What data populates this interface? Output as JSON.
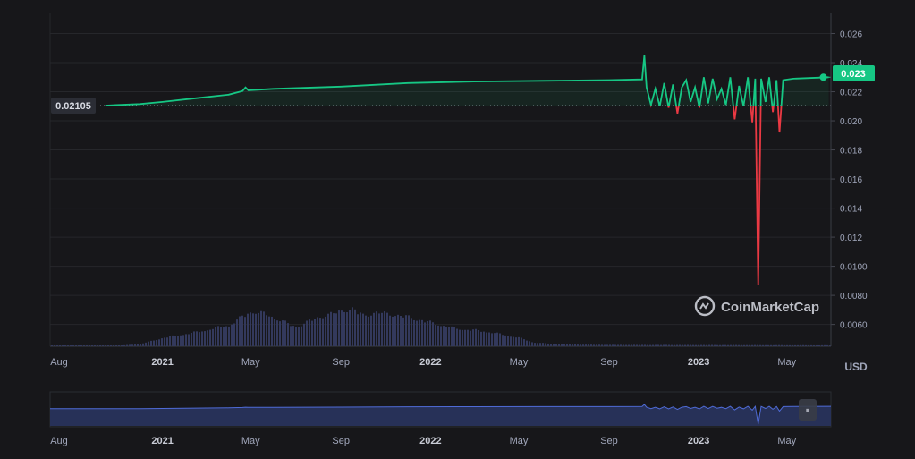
{
  "chart_data": {
    "type": "line",
    "currency_label": "USD",
    "watermark": "CoinMarketCap",
    "start_price_label": "0.02105",
    "start_price": 0.02105,
    "current_price_label": "0.023",
    "current_price": 0.023,
    "ylim": [
      0.0045,
      0.0272
    ],
    "y_ticks": [
      {
        "value": 0.026,
        "label": "0.026"
      },
      {
        "value": 0.024,
        "label": "0.024"
      },
      {
        "value": 0.022,
        "label": "0.022"
      },
      {
        "value": 0.02,
        "label": "0.020"
      },
      {
        "value": 0.018,
        "label": "0.018"
      },
      {
        "value": 0.016,
        "label": "0.016"
      },
      {
        "value": 0.014,
        "label": "0.014"
      },
      {
        "value": 0.012,
        "label": "0.012"
      },
      {
        "value": 0.01,
        "label": "0.0100"
      },
      {
        "value": 0.008,
        "label": "0.0080"
      },
      {
        "value": 0.006,
        "label": "0.0060"
      }
    ],
    "xlim": [
      "2020-08-01",
      "2023-06-30"
    ],
    "x_ticks": [
      {
        "date": "2020-08-01",
        "label": "Aug",
        "bold": false
      },
      {
        "date": "2021-01-01",
        "label": "2021",
        "bold": true
      },
      {
        "date": "2021-05-01",
        "label": "May",
        "bold": false
      },
      {
        "date": "2021-09-01",
        "label": "Sep",
        "bold": false
      },
      {
        "date": "2022-01-01",
        "label": "2022",
        "bold": true
      },
      {
        "date": "2022-05-01",
        "label": "May",
        "bold": false
      },
      {
        "date": "2022-09-01",
        "label": "Sep",
        "bold": false
      },
      {
        "date": "2023-01-01",
        "label": "2023",
        "bold": true
      },
      {
        "date": "2023-05-01",
        "label": "May",
        "bold": false
      }
    ],
    "price_series": [
      [
        "2020-10-15",
        0.02105
      ],
      [
        "2020-12-01",
        0.02115
      ],
      [
        "2021-01-01",
        0.0213
      ],
      [
        "2021-02-15",
        0.02155
      ],
      [
        "2021-04-01",
        0.0218
      ],
      [
        "2021-04-20",
        0.02205
      ],
      [
        "2021-04-24",
        0.0223
      ],
      [
        "2021-04-28",
        0.0221
      ],
      [
        "2021-06-01",
        0.0222
      ],
      [
        "2021-09-01",
        0.02235
      ],
      [
        "2021-12-01",
        0.0226
      ],
      [
        "2022-03-01",
        0.0227
      ],
      [
        "2022-06-01",
        0.02275
      ],
      [
        "2022-09-01",
        0.0228
      ],
      [
        "2022-10-16",
        0.02285
      ],
      [
        "2022-10-19",
        0.0245
      ],
      [
        "2022-10-22",
        0.0223
      ],
      [
        "2022-10-28",
        0.0211
      ],
      [
        "2022-11-03",
        0.0222
      ],
      [
        "2022-11-09",
        0.021
      ],
      [
        "2022-11-15",
        0.0226
      ],
      [
        "2022-11-21",
        0.0209
      ],
      [
        "2022-11-27",
        0.0225
      ],
      [
        "2022-12-03",
        0.0205
      ],
      [
        "2022-12-09",
        0.0223
      ],
      [
        "2022-12-15",
        0.0228
      ],
      [
        "2022-12-21",
        0.0213
      ],
      [
        "2022-12-27",
        0.0223
      ],
      [
        "2023-01-02",
        0.0209
      ],
      [
        "2023-01-08",
        0.023
      ],
      [
        "2023-01-14",
        0.0212
      ],
      [
        "2023-01-20",
        0.0229
      ],
      [
        "2023-01-26",
        0.0215
      ],
      [
        "2023-02-01",
        0.0222
      ],
      [
        "2023-02-07",
        0.0211
      ],
      [
        "2023-02-13",
        0.023
      ],
      [
        "2023-02-19",
        0.0201
      ],
      [
        "2023-02-25",
        0.0224
      ],
      [
        "2023-03-03",
        0.021
      ],
      [
        "2023-03-09",
        0.023
      ],
      [
        "2023-03-15",
        0.0199
      ],
      [
        "2023-03-19",
        0.0229
      ],
      [
        "2023-03-23",
        0.0087
      ],
      [
        "2023-03-27",
        0.0229
      ],
      [
        "2023-04-02",
        0.0213
      ],
      [
        "2023-04-07",
        0.023
      ],
      [
        "2023-04-12",
        0.0206
      ],
      [
        "2023-04-17",
        0.0228
      ],
      [
        "2023-04-21",
        0.0192
      ],
      [
        "2023-04-26",
        0.0228
      ],
      [
        "2023-05-10",
        0.0229
      ],
      [
        "2023-06-27",
        0.023
      ]
    ],
    "volume_series": [
      [
        "2020-08-01",
        0.0
      ],
      [
        "2020-11-01",
        0.01
      ],
      [
        "2020-12-01",
        0.05
      ],
      [
        "2021-01-01",
        0.18
      ],
      [
        "2021-02-15",
        0.3
      ],
      [
        "2021-04-01",
        0.45
      ],
      [
        "2021-05-01",
        0.75
      ],
      [
        "2021-05-20",
        0.68
      ],
      [
        "2021-06-10",
        0.55
      ],
      [
        "2021-07-01",
        0.4
      ],
      [
        "2021-07-20",
        0.55
      ],
      [
        "2021-08-10",
        0.66
      ],
      [
        "2021-09-15",
        0.8
      ],
      [
        "2021-10-01",
        0.65
      ],
      [
        "2021-10-20",
        0.72
      ],
      [
        "2021-12-01",
        0.62
      ],
      [
        "2022-01-01",
        0.5
      ],
      [
        "2022-02-01",
        0.38
      ],
      [
        "2022-03-15",
        0.32
      ],
      [
        "2022-05-01",
        0.18
      ],
      [
        "2022-05-20",
        0.08
      ],
      [
        "2022-07-01",
        0.04
      ],
      [
        "2022-09-01",
        0.03
      ],
      [
        "2023-03-01",
        0.025
      ],
      [
        "2023-06-30",
        0.02
      ]
    ],
    "colors": {
      "up_line": "#16c784",
      "down_line": "#ea3943",
      "volume_bar": "#33395c",
      "grid": "#26272b",
      "axis_text": "#a1a7bb",
      "bold_axis_text": "#c9ccd6",
      "navigator_fill": "#273158",
      "navigator_line": "#4f6bd6",
      "baseline": "#8a8d98"
    }
  }
}
